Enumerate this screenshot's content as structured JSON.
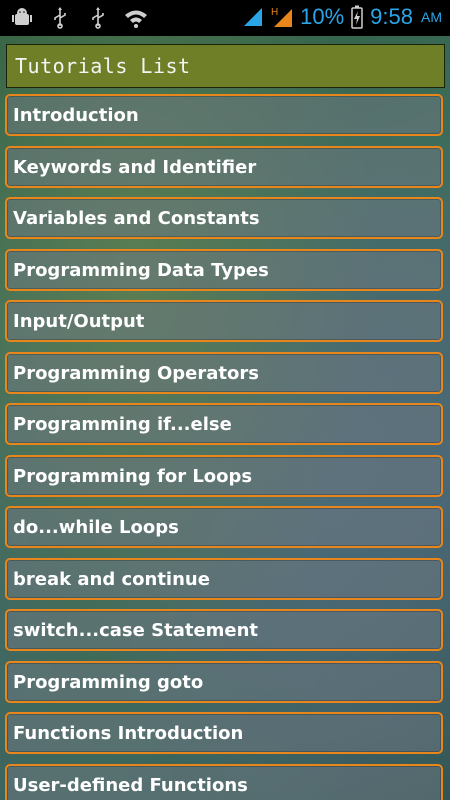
{
  "status_bar": {
    "battery": "10%",
    "time": "9:58",
    "ampm": "AM",
    "network_label": "H"
  },
  "title": "Tutorials List",
  "items": [
    "Introduction",
    "Keywords and Identifier",
    "Variables and Constants",
    "Programming Data Types",
    "Input/Output",
    "Programming Operators",
    "Programming if...else",
    "Programming for Loops",
    "do...while Loops",
    "break and continue",
    "switch...case Statement",
    "Programming goto",
    "Functions Introduction",
    "User-defined Functions"
  ],
  "colors": {
    "accent": "#e8861c",
    "title_bar": "#6f7f28",
    "status_text": "#2aa6e8"
  }
}
